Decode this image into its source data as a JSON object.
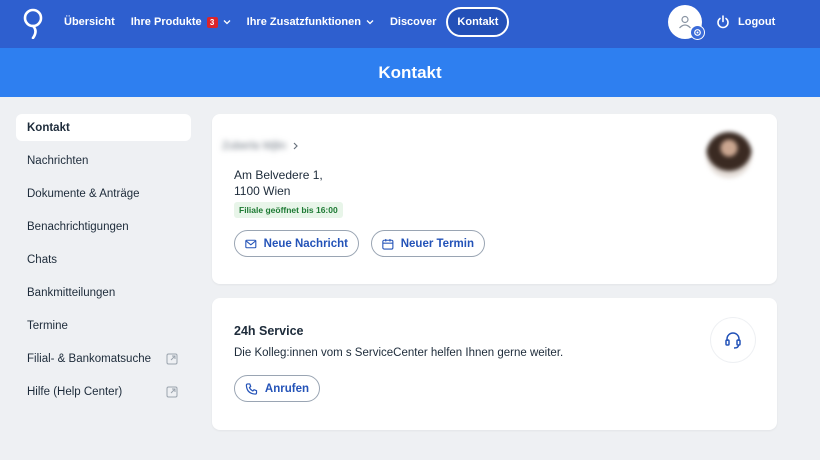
{
  "nav": {
    "items": [
      {
        "label": "Übersicht"
      },
      {
        "label": "Ihre Produkte",
        "badge": "3"
      },
      {
        "label": "Ihre Zusatzfunktionen"
      },
      {
        "label": "Discover"
      },
      {
        "label": "Kontakt"
      }
    ],
    "logout_label": "Logout"
  },
  "page": {
    "title": "Kontakt"
  },
  "sidebar": {
    "items": [
      {
        "label": "Kontakt"
      },
      {
        "label": "Nachrichten"
      },
      {
        "label": "Dokumente & Anträge"
      },
      {
        "label": "Benachrichtigungen"
      },
      {
        "label": "Chats"
      },
      {
        "label": "Bankmitteilungen"
      },
      {
        "label": "Termine"
      },
      {
        "label": "Filial- & Bankomatsuche"
      },
      {
        "label": "Hilfe (Help Center)"
      }
    ]
  },
  "advisor": {
    "name": "Zuberla Wjlin",
    "address_line1": "Am Belvedere 1,",
    "address_line2": "1100 Wien",
    "status": "Filiale geöffnet bis 16:00",
    "new_message_label": "Neue Nachricht",
    "new_appointment_label": "Neuer Termin"
  },
  "service": {
    "title": "24h Service",
    "text": "Die Kolleg:innen vom s ServiceCenter helfen Ihnen gerne weiter.",
    "call_label": "Anrufen"
  },
  "colors": {
    "nav_bg": "#2e5fcf",
    "banner_bg": "#2e7ff0",
    "badge_red": "#d9252b",
    "link_blue": "#2453b8",
    "status_green": "#1d7a33"
  },
  "icons": [
    "logo-icon",
    "chevron-down-icon",
    "user-icon",
    "settings-icon",
    "power-icon",
    "chevron-right-icon",
    "mail-icon",
    "calendar-icon",
    "external-link-icon",
    "phone-icon",
    "headset-icon"
  ]
}
